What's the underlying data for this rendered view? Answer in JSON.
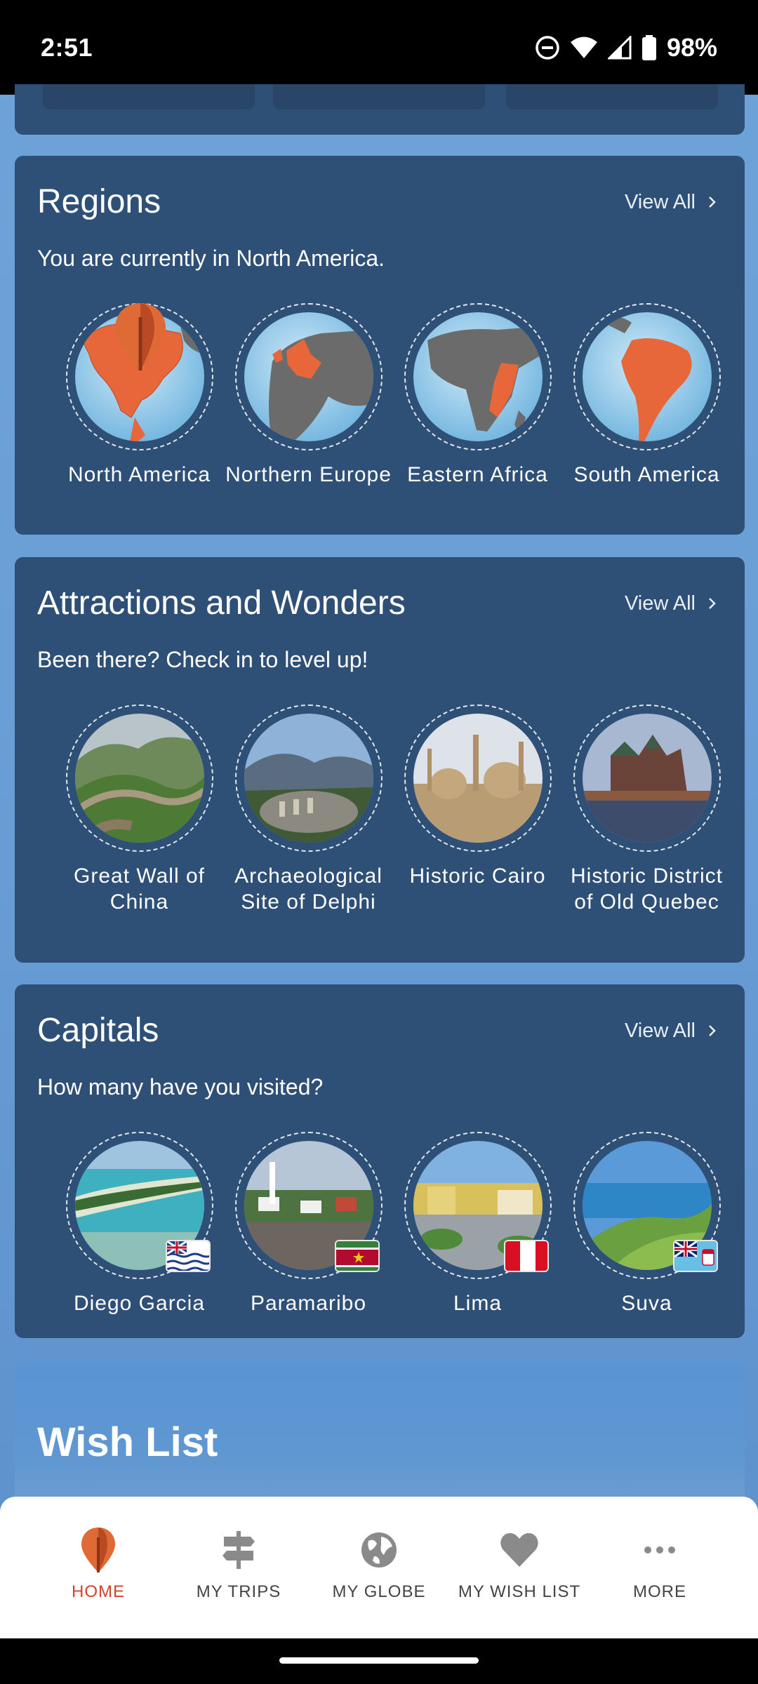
{
  "status_bar": {
    "time": "2:51",
    "battery": "98%"
  },
  "regions": {
    "title": "Regions",
    "view_all": "View All",
    "subtitle": "You are currently in North America.",
    "items": [
      {
        "label": "North America",
        "icon": "globe-north-america"
      },
      {
        "label": "Northern Europe",
        "icon": "globe-northern-europe"
      },
      {
        "label": "Eastern Africa",
        "icon": "globe-eastern-africa"
      },
      {
        "label": "South America",
        "icon": "globe-south-america"
      }
    ]
  },
  "attractions": {
    "title": "Attractions and Wonders",
    "view_all": "View All",
    "subtitle": "Been there? Check in to level up!",
    "items": [
      {
        "label": "Great Wall of China"
      },
      {
        "label": "Archaeological Site of Delphi"
      },
      {
        "label": "Historic Cairo"
      },
      {
        "label": "Historic District of Old Quebec"
      }
    ]
  },
  "capitals": {
    "title": "Capitals",
    "view_all": "View All",
    "subtitle": "How many have you visited?",
    "items": [
      {
        "label": "Diego Garcia"
      },
      {
        "label": "Paramaribo"
      },
      {
        "label": "Lima"
      },
      {
        "label": "Suva"
      }
    ]
  },
  "wishlist": {
    "title": "Wish List"
  },
  "bottom_nav": {
    "items": [
      {
        "label": "HOME",
        "icon": "map-pin-icon",
        "active": true
      },
      {
        "label": "MY TRIPS",
        "icon": "signpost-icon",
        "active": false
      },
      {
        "label": "MY GLOBE",
        "icon": "globe-icon",
        "active": false
      },
      {
        "label": "MY WISH LIST",
        "icon": "heart-icon",
        "active": false
      },
      {
        "label": "MORE",
        "icon": "more-dots-icon",
        "active": false
      }
    ]
  },
  "colors": {
    "card_bg": "#2e4f76",
    "accent_orange": "#e8673a",
    "active_nav": "#d8412b",
    "page_bg": "#6ea3d8"
  }
}
